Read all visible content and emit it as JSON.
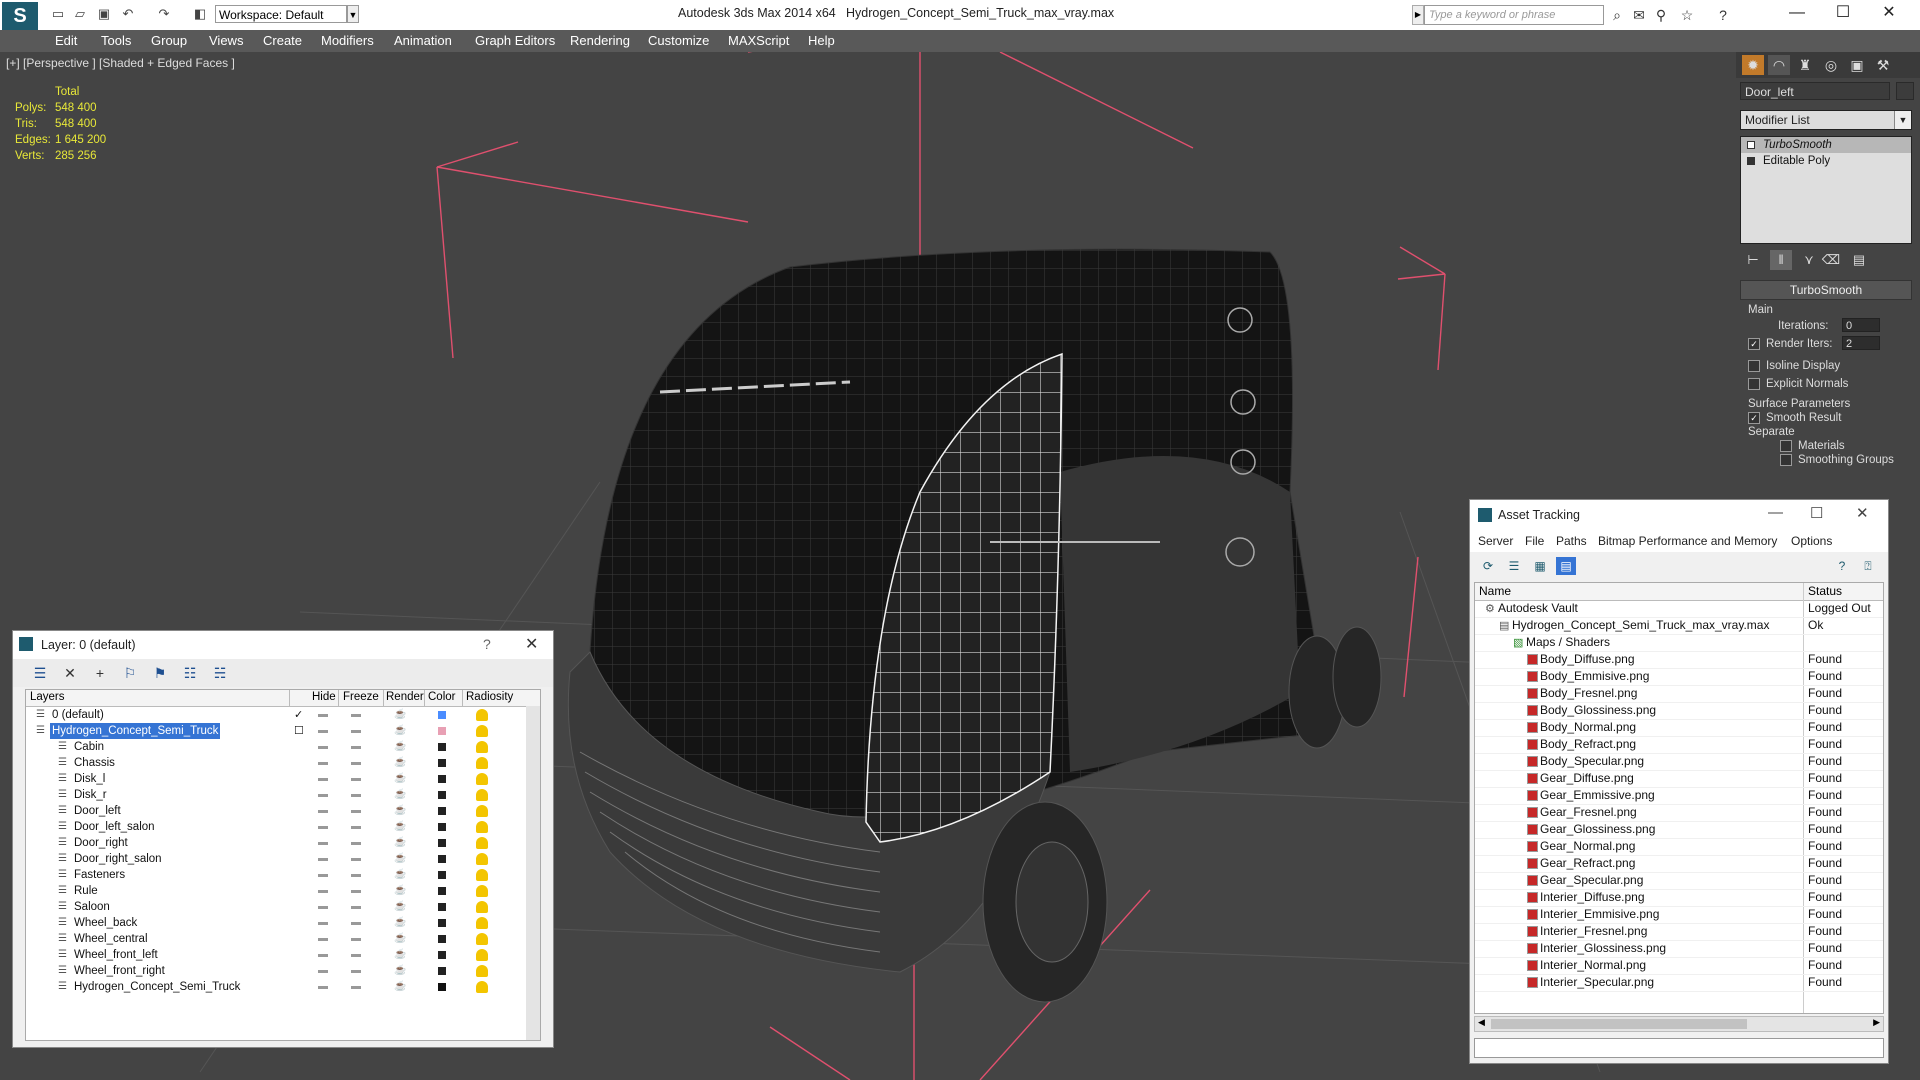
{
  "app": {
    "title": "Autodesk 3ds Max  2014 x64",
    "document": "Hydrogen_Concept_Semi_Truck_max_vray.max",
    "workspace": "Workspace: Default",
    "search_placeholder": "Type a keyword or phrase"
  },
  "menu": [
    "Edit",
    "Tools",
    "Group",
    "Views",
    "Create",
    "Modifiers",
    "Animation",
    "Graph Editors",
    "Rendering",
    "Customize",
    "MAXScript",
    "Help"
  ],
  "viewport": {
    "label": "[+] [Perspective ] [Shaded + Edged Faces ]",
    "stats": {
      "header": "Total",
      "rows": [
        {
          "label": "Polys:",
          "value": "548 400"
        },
        {
          "label": "Tris:",
          "value": "548 400"
        },
        {
          "label": "Edges:",
          "value": "1 645 200"
        },
        {
          "label": "Verts:",
          "value": "285 256"
        }
      ]
    }
  },
  "command_panel": {
    "object_name": "Door_left",
    "modifier_list": "Modifier List",
    "stack": [
      "TurboSmooth",
      "Editable Poly"
    ],
    "rollout_title": "TurboSmooth",
    "main_label": "Main",
    "iterations_label": "Iterations:",
    "iterations_value": "0",
    "render_iters_label": "Render Iters:",
    "render_iters_value": "2",
    "isoline_label": "Isoline Display",
    "explicit_normals_label": "Explicit Normals",
    "surface_params_label": "Surface Parameters",
    "smooth_result_label": "Smooth Result",
    "separate_label": "Separate",
    "materials_label": "Materials",
    "smoothing_groups_label": "Smoothing Groups"
  },
  "layer_window": {
    "title": "Layer: 0 (default)",
    "columns": [
      "Layers",
      "Hide",
      "Freeze",
      "Render",
      "Color",
      "Radiosity"
    ],
    "rows": [
      {
        "name": "0 (default)",
        "color": "#4a8cff",
        "level": 0
      },
      {
        "name": "Hydrogen_Concept_Semi_Truck",
        "color": "#e8a0b4",
        "level": 0,
        "selected": true
      },
      {
        "name": "Cabin",
        "color": "#222222",
        "level": 1
      },
      {
        "name": "Chassis",
        "color": "#222222",
        "level": 1
      },
      {
        "name": "Disk_l",
        "color": "#222222",
        "level": 1
      },
      {
        "name": "Disk_r",
        "color": "#222222",
        "level": 1
      },
      {
        "name": "Door_left",
        "color": "#222222",
        "level": 1
      },
      {
        "name": "Door_left_salon",
        "color": "#222222",
        "level": 1
      },
      {
        "name": "Door_right",
        "color": "#222222",
        "level": 1
      },
      {
        "name": "Door_right_salon",
        "color": "#222222",
        "level": 1
      },
      {
        "name": "Fasteners",
        "color": "#222222",
        "level": 1
      },
      {
        "name": "Rule",
        "color": "#222222",
        "level": 1
      },
      {
        "name": "Saloon",
        "color": "#222222",
        "level": 1
      },
      {
        "name": "Wheel_back",
        "color": "#222222",
        "level": 1
      },
      {
        "name": "Wheel_central",
        "color": "#222222",
        "level": 1
      },
      {
        "name": "Wheel_front_left",
        "color": "#222222",
        "level": 1
      },
      {
        "name": "Wheel_front_right",
        "color": "#222222",
        "level": 1
      },
      {
        "name": "Hydrogen_Concept_Semi_Truck",
        "color": "#111111",
        "level": 1
      }
    ]
  },
  "asset_window": {
    "title": "Asset Tracking",
    "menu": [
      "Server",
      "File",
      "Paths",
      "Bitmap Performance and Memory",
      "Options"
    ],
    "columns": [
      "Name",
      "Status"
    ],
    "rows": [
      {
        "name": "Autodesk Vault",
        "status": "Logged Out",
        "level": 0,
        "icon": "vault"
      },
      {
        "name": "Hydrogen_Concept_Semi_Truck_max_vray.max",
        "status": "Ok",
        "level": 1,
        "icon": "max"
      },
      {
        "name": "Maps / Shaders",
        "status": "",
        "level": 2,
        "icon": "folder"
      },
      {
        "name": "Body_Diffuse.png",
        "status": "Found",
        "level": 3,
        "icon": "png"
      },
      {
        "name": "Body_Emmisive.png",
        "status": "Found",
        "level": 3,
        "icon": "png"
      },
      {
        "name": "Body_Fresnel.png",
        "status": "Found",
        "level": 3,
        "icon": "png"
      },
      {
        "name": "Body_Glossiness.png",
        "status": "Found",
        "level": 3,
        "icon": "png"
      },
      {
        "name": "Body_Normal.png",
        "status": "Found",
        "level": 3,
        "icon": "png"
      },
      {
        "name": "Body_Refract.png",
        "status": "Found",
        "level": 3,
        "icon": "png"
      },
      {
        "name": "Body_Specular.png",
        "status": "Found",
        "level": 3,
        "icon": "png"
      },
      {
        "name": "Gear_Diffuse.png",
        "status": "Found",
        "level": 3,
        "icon": "png"
      },
      {
        "name": "Gear_Emmissive.png",
        "status": "Found",
        "level": 3,
        "icon": "png"
      },
      {
        "name": "Gear_Fresnel.png",
        "status": "Found",
        "level": 3,
        "icon": "png"
      },
      {
        "name": "Gear_Glossiness.png",
        "status": "Found",
        "level": 3,
        "icon": "png"
      },
      {
        "name": "Gear_Normal.png",
        "status": "Found",
        "level": 3,
        "icon": "png"
      },
      {
        "name": "Gear_Refract.png",
        "status": "Found",
        "level": 3,
        "icon": "png"
      },
      {
        "name": "Gear_Specular.png",
        "status": "Found",
        "level": 3,
        "icon": "png"
      },
      {
        "name": "Interier_Diffuse.png",
        "status": "Found",
        "level": 3,
        "icon": "png"
      },
      {
        "name": "Interier_Emmisive.png",
        "status": "Found",
        "level": 3,
        "icon": "png"
      },
      {
        "name": "Interier_Fresnel.png",
        "status": "Found",
        "level": 3,
        "icon": "png"
      },
      {
        "name": "Interier_Glossiness.png",
        "status": "Found",
        "level": 3,
        "icon": "png"
      },
      {
        "name": "Interier_Normal.png",
        "status": "Found",
        "level": 3,
        "icon": "png"
      },
      {
        "name": "Interier_Specular.png",
        "status": "Found",
        "level": 3,
        "icon": "png"
      }
    ]
  },
  "colors": {
    "viewport_bg": "#444444",
    "selection": "#3574d4",
    "stats_text": "#e8e838",
    "light_gizmo": "#e0506e"
  }
}
